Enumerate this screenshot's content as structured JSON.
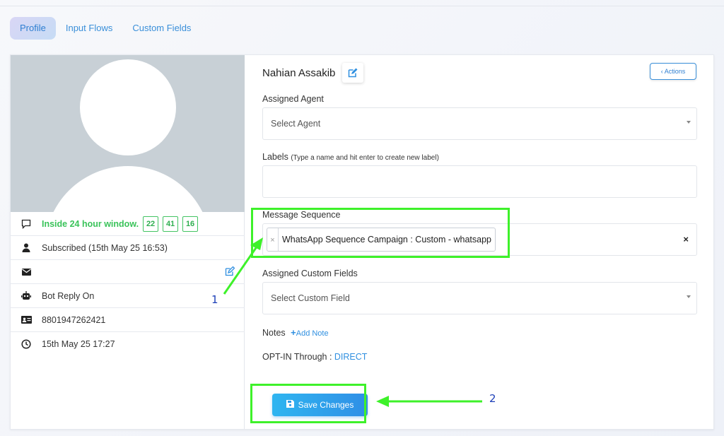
{
  "tabs": [
    {
      "label": "Profile"
    },
    {
      "label": "Input Flows"
    },
    {
      "label": "Custom Fields"
    }
  ],
  "profile": {
    "window_text": "Inside 24 hour window.",
    "counters": [
      "22",
      "41",
      "16"
    ],
    "subscribed": "Subscribed (15th May 25 16:53)",
    "email": "",
    "bot_reply": "Bot Reply On",
    "phone": "8801947262421",
    "time": "15th May 25 17:27"
  },
  "contact": {
    "name": "Nahian Assakib",
    "actions_label": "‹ Actions"
  },
  "form": {
    "assigned_agent_label": "Assigned Agent",
    "assigned_agent_value": "Select Agent",
    "labels_label": "Labels",
    "labels_hint": "(Type a name and hit enter to create new label)",
    "labels_value": "",
    "message_sequence_label": "Message Sequence",
    "message_sequence_chip": "WhatsApp Sequence Campaign : Custom - whatsapp",
    "custom_fields_label": "Assigned Custom Fields",
    "custom_fields_value": "Select Custom Field",
    "notes_label": "Notes",
    "add_note_label": "Add Note",
    "optin_label": "OPT-IN Through :",
    "optin_value": "DIRECT",
    "save_label": "Save Changes"
  },
  "annotations": {
    "one": "1",
    "two": "2"
  },
  "colors": {
    "accent": "#2f8fe0",
    "highlight": "#3ef12a",
    "status_green": "#3ac35a",
    "annotation_text": "#1d3fb8"
  }
}
